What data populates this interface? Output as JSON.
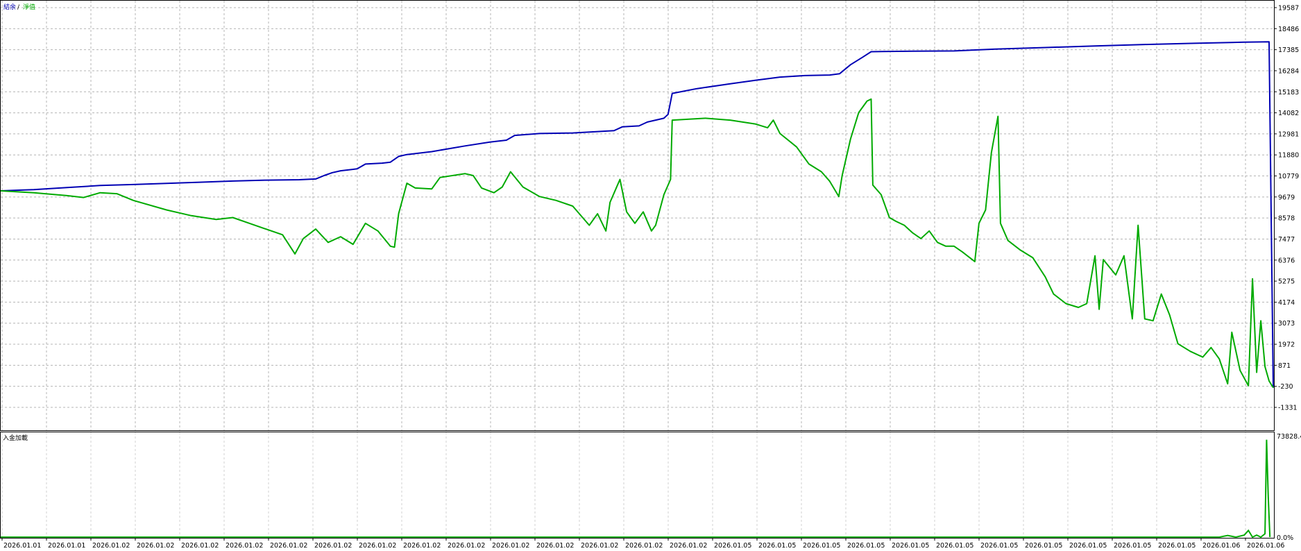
{
  "legend": {
    "balance_label": "結余",
    "separator": "/",
    "equity_label": "淨值",
    "balance_color": "#0000b4",
    "equity_color": "#00aa00"
  },
  "lower_panel": {
    "label": "入金加載",
    "y_max_label": "73828.4",
    "y_min_label": "0.0%"
  },
  "chart_data": {
    "type": "line",
    "x_tick_labels": [
      "2026.01.01",
      "2026.01.01",
      "2026.01.02",
      "2026.01.02",
      "2026.01.02",
      "2026.01.02",
      "2026.01.02",
      "2026.01.02",
      "2026.01.02",
      "2026.01.02",
      "2026.01.02",
      "2026.01.02",
      "2026.01.02",
      "2026.01.02",
      "2026.01.02",
      "2026.01.02",
      "2026.01.05",
      "2026.01.05",
      "2026.01.05",
      "2026.01.05",
      "2026.01.05",
      "2026.01.05",
      "2026.01.05",
      "2026.01.05",
      "2026.01.05",
      "2026.01.05",
      "2026.01.05",
      "2026.01.06",
      "2026.01.06"
    ],
    "y_tick_labels": [
      "19587",
      "18486",
      "17385",
      "16284",
      "15183",
      "14082",
      "12981",
      "11880",
      "10779",
      "9679",
      "8578",
      "7477",
      "6376",
      "5275",
      "4174",
      "3073",
      "1972",
      "871",
      "-230",
      "-1331"
    ],
    "ylim": [
      -1331,
      19587
    ],
    "grid": true,
    "series": [
      {
        "name": "結余",
        "color": "#0000b4",
        "points": [
          [
            0,
            10000
          ],
          [
            40,
            10060
          ],
          [
            80,
            10170
          ],
          [
            120,
            10280
          ],
          [
            160,
            10330
          ],
          [
            200,
            10390
          ],
          [
            240,
            10450
          ],
          [
            280,
            10510
          ],
          [
            320,
            10560
          ],
          [
            360,
            10580
          ],
          [
            380,
            10620
          ],
          [
            390,
            10800
          ],
          [
            400,
            10950
          ],
          [
            410,
            11050
          ],
          [
            430,
            11150
          ],
          [
            440,
            11400
          ],
          [
            460,
            11450
          ],
          [
            470,
            11500
          ],
          [
            480,
            11800
          ],
          [
            490,
            11900
          ],
          [
            520,
            12050
          ],
          [
            560,
            12350
          ],
          [
            590,
            12550
          ],
          [
            610,
            12650
          ],
          [
            620,
            12900
          ],
          [
            650,
            13000
          ],
          [
            690,
            13030
          ],
          [
            720,
            13100
          ],
          [
            740,
            13150
          ],
          [
            750,
            13350
          ],
          [
            770,
            13400
          ],
          [
            780,
            13600
          ],
          [
            800,
            13800
          ],
          [
            805,
            14000
          ],
          [
            810,
            15100
          ],
          [
            840,
            15350
          ],
          [
            880,
            15600
          ],
          [
            910,
            15780
          ],
          [
            940,
            15950
          ],
          [
            970,
            16030
          ],
          [
            1000,
            16060
          ],
          [
            1012,
            16130
          ],
          [
            1025,
            16600
          ],
          [
            1040,
            17000
          ],
          [
            1050,
            17280
          ],
          [
            1100,
            17310
          ],
          [
            1150,
            17320
          ],
          [
            1200,
            17420
          ],
          [
            1260,
            17500
          ],
          [
            1320,
            17580
          ],
          [
            1380,
            17660
          ],
          [
            1440,
            17720
          ],
          [
            1500,
            17780
          ],
          [
            1530,
            17800
          ],
          [
            1535,
            -300
          ]
        ]
      },
      {
        "name": "淨值",
        "color": "#00aa00",
        "points": [
          [
            0,
            10000
          ],
          [
            40,
            9900
          ],
          [
            80,
            9750
          ],
          [
            100,
            9650
          ],
          [
            120,
            9900
          ],
          [
            140,
            9850
          ],
          [
            160,
            9500
          ],
          [
            200,
            9000
          ],
          [
            230,
            8700
          ],
          [
            260,
            8500
          ],
          [
            280,
            8600
          ],
          [
            300,
            8300
          ],
          [
            320,
            8000
          ],
          [
            340,
            7700
          ],
          [
            355,
            6700
          ],
          [
            365,
            7500
          ],
          [
            380,
            8000
          ],
          [
            395,
            7300
          ],
          [
            410,
            7600
          ],
          [
            425,
            7200
          ],
          [
            440,
            8300
          ],
          [
            455,
            7900
          ],
          [
            470,
            7100
          ],
          [
            475,
            7050
          ],
          [
            480,
            8800
          ],
          [
            490,
            10400
          ],
          [
            500,
            10150
          ],
          [
            520,
            10100
          ],
          [
            530,
            10700
          ],
          [
            560,
            10900
          ],
          [
            570,
            10800
          ],
          [
            580,
            10150
          ],
          [
            595,
            9900
          ],
          [
            605,
            10200
          ],
          [
            615,
            11000
          ],
          [
            630,
            10200
          ],
          [
            650,
            9700
          ],
          [
            670,
            9500
          ],
          [
            690,
            9200
          ],
          [
            710,
            8200
          ],
          [
            720,
            8800
          ],
          [
            730,
            7900
          ],
          [
            735,
            9400
          ],
          [
            747,
            10600
          ],
          [
            755,
            8900
          ],
          [
            765,
            8300
          ],
          [
            775,
            8900
          ],
          [
            785,
            7900
          ],
          [
            790,
            8200
          ],
          [
            800,
            9800
          ],
          [
            808,
            10600
          ],
          [
            810,
            13700
          ],
          [
            850,
            13800
          ],
          [
            880,
            13700
          ],
          [
            910,
            13500
          ],
          [
            925,
            13300
          ],
          [
            932,
            13700
          ],
          [
            940,
            13000
          ],
          [
            960,
            12300
          ],
          [
            975,
            11400
          ],
          [
            990,
            11000
          ],
          [
            1000,
            10500
          ],
          [
            1011,
            9700
          ],
          [
            1015,
            10800
          ],
          [
            1025,
            12700
          ],
          [
            1035,
            14100
          ],
          [
            1045,
            14700
          ],
          [
            1050,
            14800
          ],
          [
            1052,
            10300
          ],
          [
            1062,
            9800
          ],
          [
            1072,
            8600
          ],
          [
            1080,
            8400
          ],
          [
            1090,
            8200
          ],
          [
            1100,
            7800
          ],
          [
            1110,
            7500
          ],
          [
            1120,
            7900
          ],
          [
            1130,
            7300
          ],
          [
            1140,
            7100
          ],
          [
            1150,
            7100
          ],
          [
            1160,
            6800
          ],
          [
            1175,
            6300
          ],
          [
            1180,
            8300
          ],
          [
            1188,
            9000
          ],
          [
            1195,
            12000
          ],
          [
            1203,
            13900
          ],
          [
            1206,
            8300
          ],
          [
            1215,
            7400
          ],
          [
            1230,
            6900
          ],
          [
            1245,
            6500
          ],
          [
            1260,
            5500
          ],
          [
            1270,
            4600
          ],
          [
            1285,
            4100
          ],
          [
            1300,
            3900
          ],
          [
            1310,
            4100
          ],
          [
            1320,
            6600
          ],
          [
            1325,
            3800
          ],
          [
            1330,
            6400
          ],
          [
            1345,
            5600
          ],
          [
            1355,
            6600
          ],
          [
            1365,
            3300
          ],
          [
            1372,
            8200
          ],
          [
            1380,
            3300
          ],
          [
            1390,
            3200
          ],
          [
            1400,
            4600
          ],
          [
            1410,
            3500
          ],
          [
            1420,
            2000
          ],
          [
            1435,
            1600
          ],
          [
            1450,
            1300
          ],
          [
            1460,
            1800
          ],
          [
            1470,
            1200
          ],
          [
            1480,
            -100
          ],
          [
            1485,
            2600
          ],
          [
            1495,
            600
          ],
          [
            1505,
            -200
          ],
          [
            1510,
            5400
          ],
          [
            1515,
            500
          ],
          [
            1520,
            3200
          ],
          [
            1525,
            800
          ],
          [
            1530,
            50
          ],
          [
            1535,
            -300
          ]
        ]
      }
    ],
    "lower_series": {
      "name": "入金加載",
      "ylim": [
        0,
        73828.4
      ],
      "points": [
        [
          0,
          0
        ],
        [
          1400,
          0
        ],
        [
          1470,
          0
        ],
        [
          1480,
          1200
        ],
        [
          1490,
          0
        ],
        [
          1500,
          1500
        ],
        [
          1505,
          5000
        ],
        [
          1510,
          0
        ],
        [
          1515,
          1500
        ],
        [
          1520,
          0
        ],
        [
          1525,
          2500
        ],
        [
          1527,
          73000
        ],
        [
          1529,
          30000
        ],
        [
          1531,
          0
        ]
      ]
    }
  }
}
